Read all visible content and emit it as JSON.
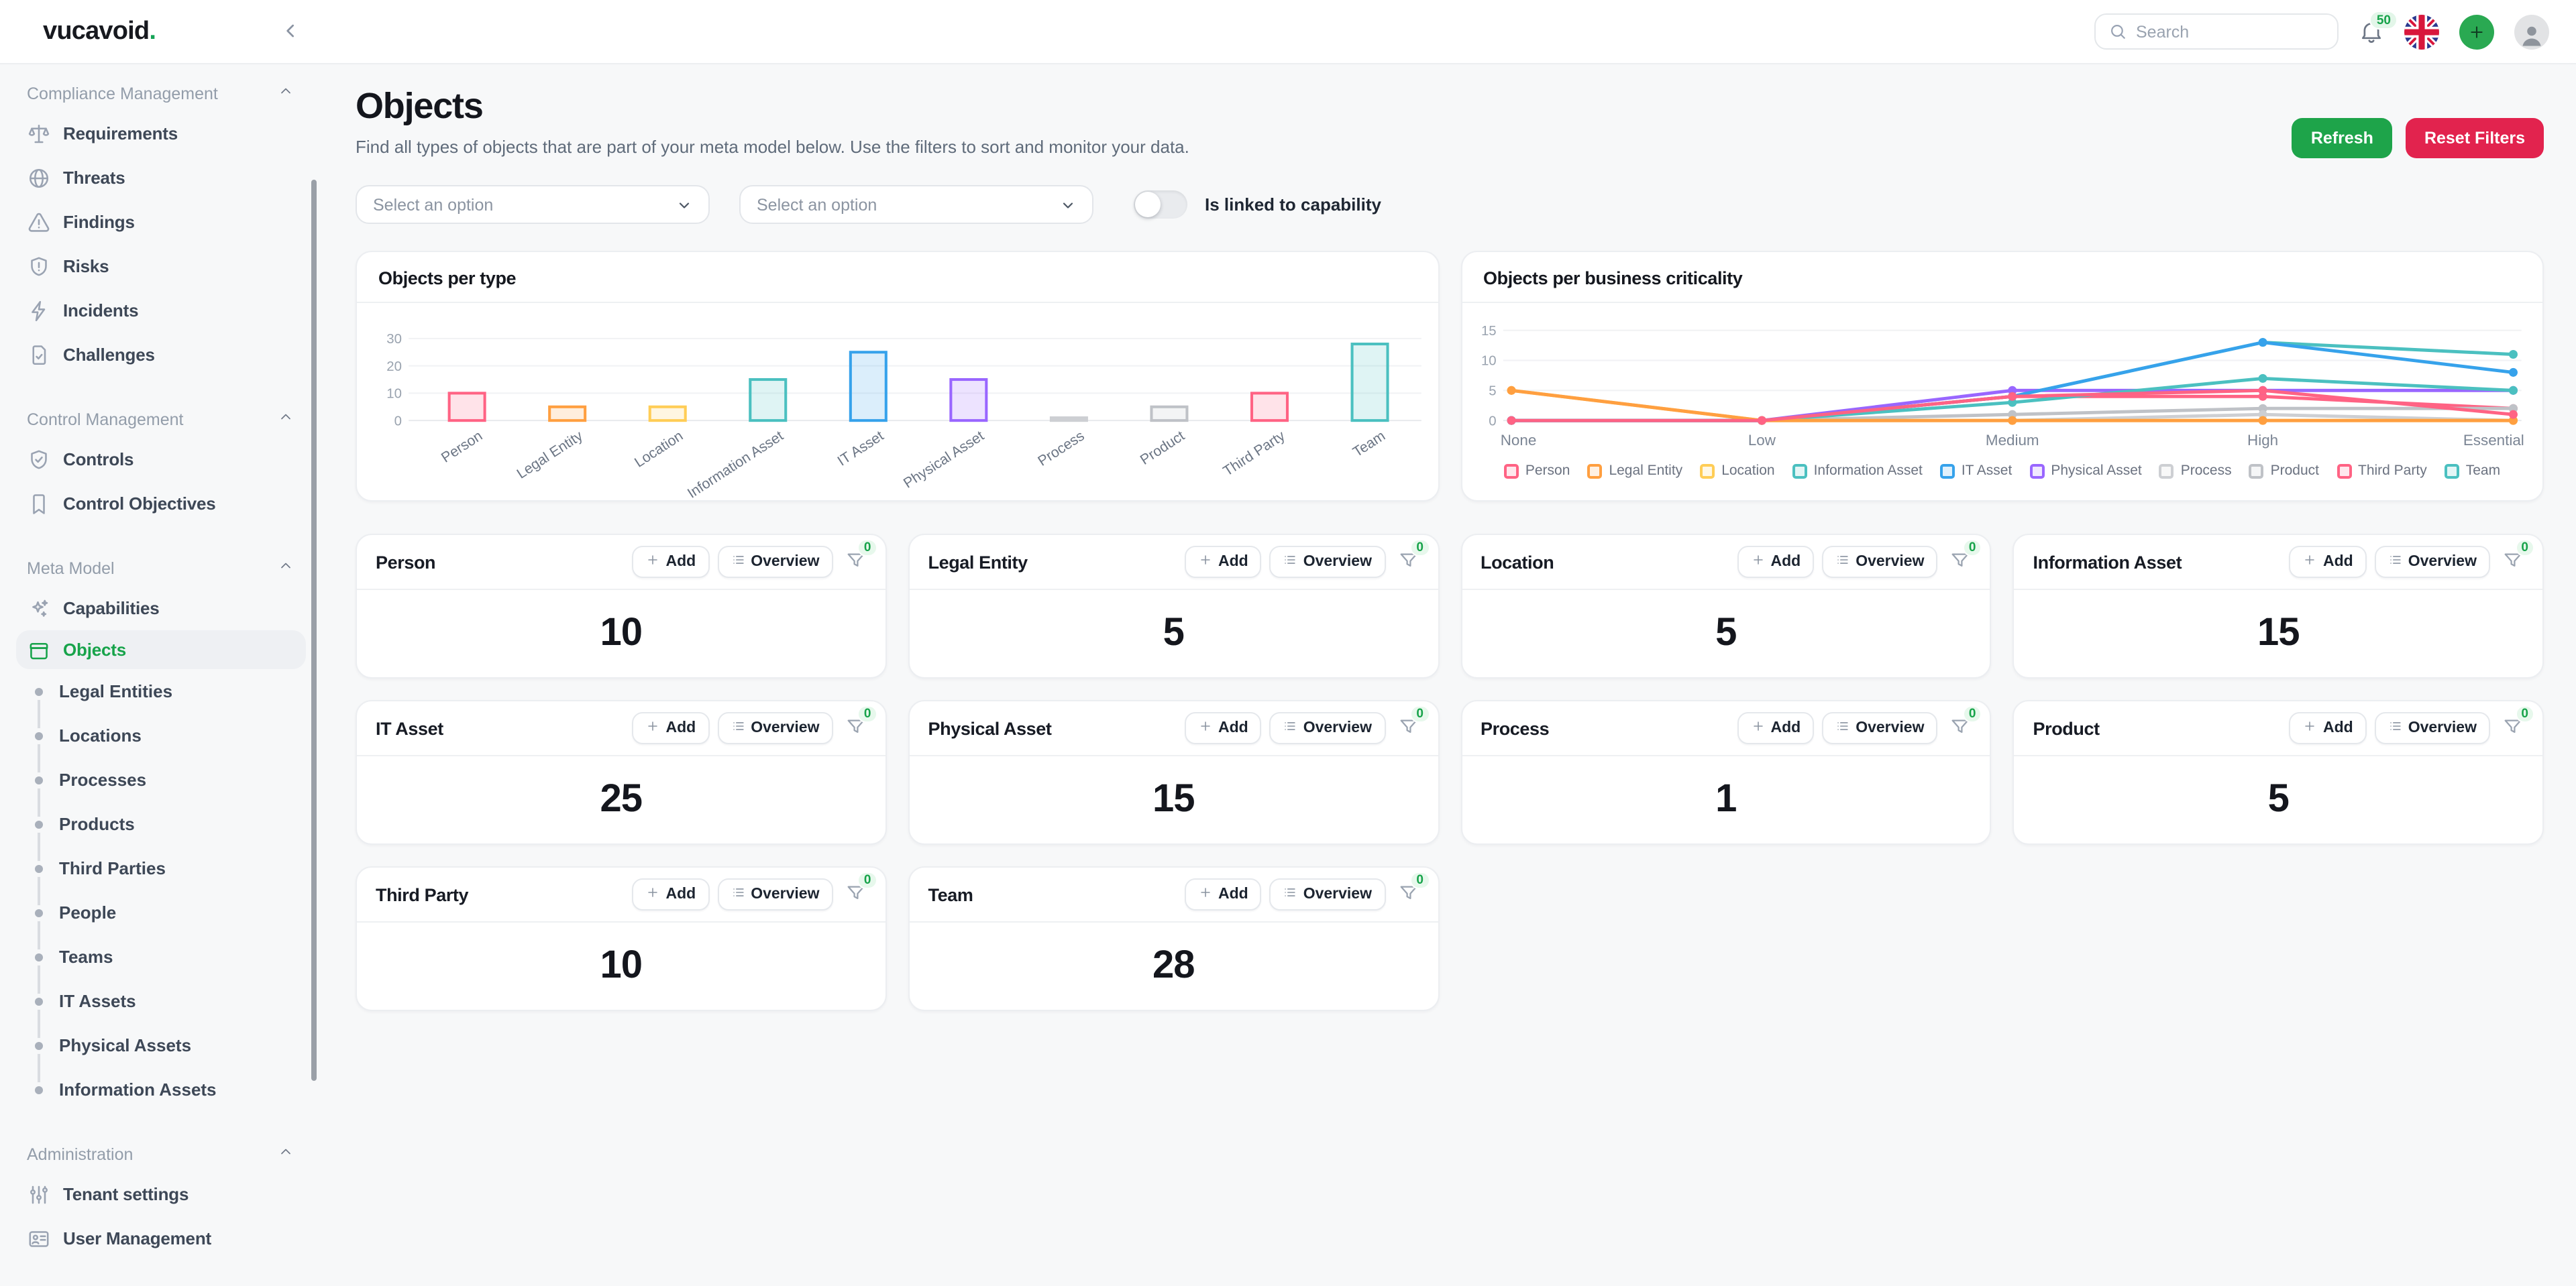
{
  "topbar": {
    "logo": "vucavoid",
    "logo_dot": ".",
    "search_placeholder": "Search",
    "notification_count": "50"
  },
  "page": {
    "title": "Objects",
    "subtitle": "Find all types of objects that are part of your meta model below. Use the filters to sort and monitor your data.",
    "refresh_label": "Refresh",
    "reset_label": "Reset Filters"
  },
  "filters": {
    "select1_placeholder": "Select an option",
    "select2_placeholder": "Select an option",
    "toggle_label": "Is linked to capability",
    "toggle_state": "off"
  },
  "sidebar": {
    "sections": [
      {
        "label": "Compliance Management",
        "items": [
          {
            "label": "Requirements",
            "icon": "scale"
          },
          {
            "label": "Threats",
            "icon": "globe"
          },
          {
            "label": "Findings",
            "icon": "warning-triangle"
          },
          {
            "label": "Risks",
            "icon": "shield-alert"
          },
          {
            "label": "Incidents",
            "icon": "bolt"
          },
          {
            "label": "Challenges",
            "icon": "doc-check"
          }
        ]
      },
      {
        "label": "Control Management",
        "items": [
          {
            "label": "Controls",
            "icon": "shield-check"
          },
          {
            "label": "Control Objectives",
            "icon": "bookmark"
          }
        ]
      },
      {
        "label": "Meta Model",
        "items": [
          {
            "label": "Capabilities",
            "icon": "sparkles"
          },
          {
            "label": "Objects",
            "icon": "box",
            "active": true
          },
          {
            "label": "Legal Entities",
            "bullet": true
          },
          {
            "label": "Locations",
            "bullet": true
          },
          {
            "label": "Processes",
            "bullet": true
          },
          {
            "label": "Products",
            "bullet": true
          },
          {
            "label": "Third Parties",
            "bullet": true
          },
          {
            "label": "People",
            "bullet": true
          },
          {
            "label": "Teams",
            "bullet": true
          },
          {
            "label": "IT Assets",
            "bullet": true
          },
          {
            "label": "Physical Assets",
            "bullet": true
          },
          {
            "label": "Information Assets",
            "bullet": true
          }
        ]
      },
      {
        "label": "Administration",
        "items": [
          {
            "label": "Tenant settings",
            "icon": "sliders"
          },
          {
            "label": "User Management",
            "icon": "id-card"
          }
        ]
      }
    ]
  },
  "card_actions": {
    "add": "Add",
    "overview": "Overview",
    "badge": "0"
  },
  "cards": [
    {
      "title": "Person",
      "value": "10"
    },
    {
      "title": "Legal Entity",
      "value": "5"
    },
    {
      "title": "Location",
      "value": "5"
    },
    {
      "title": "Information Asset",
      "value": "15"
    },
    {
      "title": "IT Asset",
      "value": "25"
    },
    {
      "title": "Physical Asset",
      "value": "15"
    },
    {
      "title": "Process",
      "value": "1"
    },
    {
      "title": "Product",
      "value": "5"
    },
    {
      "title": "Third Party",
      "value": "10"
    },
    {
      "title": "Team",
      "value": "28"
    }
  ],
  "chart_data": [
    {
      "type": "bar",
      "title": "Objects per type",
      "categories": [
        "Person",
        "Legal Entity",
        "Location",
        "Information Asset",
        "IT Asset",
        "Physical Asset",
        "Process",
        "Product",
        "Third Party",
        "Team"
      ],
      "values": [
        10,
        5,
        5,
        15,
        25,
        15,
        1,
        5,
        10,
        28
      ],
      "colors": [
        "#FF6384",
        "#FF9F40",
        "#FFCD56",
        "#4BC0C0",
        "#36A2EB",
        "#9966FF",
        "#CDCFD3",
        "#BFC2C7",
        "#FF6384",
        "#4BC0C0"
      ],
      "ylim": [
        0,
        30
      ],
      "yticks": [
        0,
        10,
        20,
        30
      ],
      "grid": true,
      "legend_position": "none"
    },
    {
      "type": "line",
      "title": "Objects per business criticality",
      "x": [
        "None",
        "Low",
        "Medium",
        "High",
        "Essential"
      ],
      "series": [
        {
          "name": "Person",
          "color": "#FF6384",
          "values": [
            0,
            0,
            4,
            5,
            1
          ]
        },
        {
          "name": "Legal Entity",
          "color": "#FF9F40",
          "values": [
            5,
            0,
            0,
            0,
            0
          ]
        },
        {
          "name": "Location",
          "color": "#FFCD56",
          "values": [
            5,
            0,
            0,
            0,
            0
          ]
        },
        {
          "name": "Information Asset",
          "color": "#4BC0C0",
          "values": [
            0,
            0,
            3,
            7,
            5
          ]
        },
        {
          "name": "IT Asset",
          "color": "#36A2EB",
          "values": [
            0,
            0,
            4,
            13,
            8
          ]
        },
        {
          "name": "Physical Asset",
          "color": "#9966FF",
          "values": [
            0,
            0,
            5,
            5,
            5
          ]
        },
        {
          "name": "Process",
          "color": "#CDCFD3",
          "values": [
            0,
            0,
            0,
            1,
            0
          ]
        },
        {
          "name": "Product",
          "color": "#BFC2C7",
          "values": [
            0,
            0,
            1,
            2,
            2
          ]
        },
        {
          "name": "Third Party",
          "color": "#FF6384",
          "values": [
            0,
            0,
            4,
            4,
            2
          ]
        },
        {
          "name": "Team",
          "color": "#4BC0C0",
          "values": [
            0,
            0,
            4,
            13,
            11
          ]
        }
      ],
      "ylim": [
        0,
        15
      ],
      "yticks": [
        0,
        5,
        10,
        15
      ],
      "grid": true,
      "legend_position": "bottom"
    }
  ]
}
